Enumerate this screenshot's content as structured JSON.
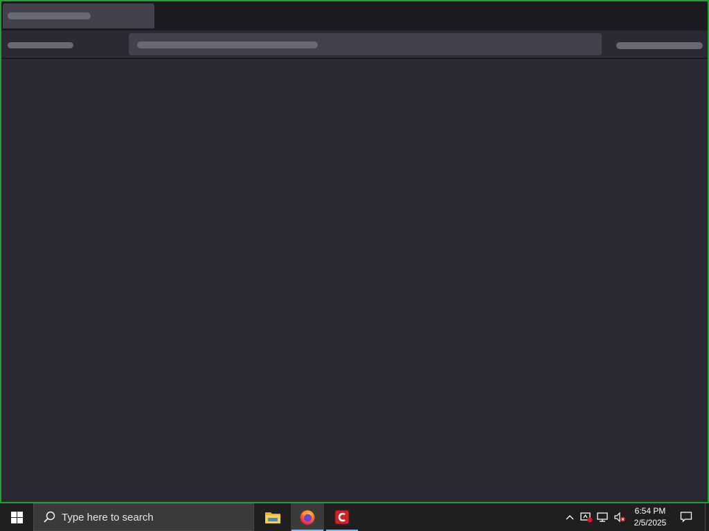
{
  "taskbar": {
    "search_placeholder": "Type here to search",
    "apps": [
      "file-explorer",
      "firefox",
      "ccleaner"
    ],
    "active_app": "firefox"
  },
  "clock": {
    "time": "6:54 PM",
    "date": "2/5/2025"
  },
  "colors": {
    "window_border": "#1fa333",
    "content_bg": "#2b2a33",
    "tabbar_bg": "#1c1b22",
    "taskbar_bg": "#1f1f1f"
  }
}
